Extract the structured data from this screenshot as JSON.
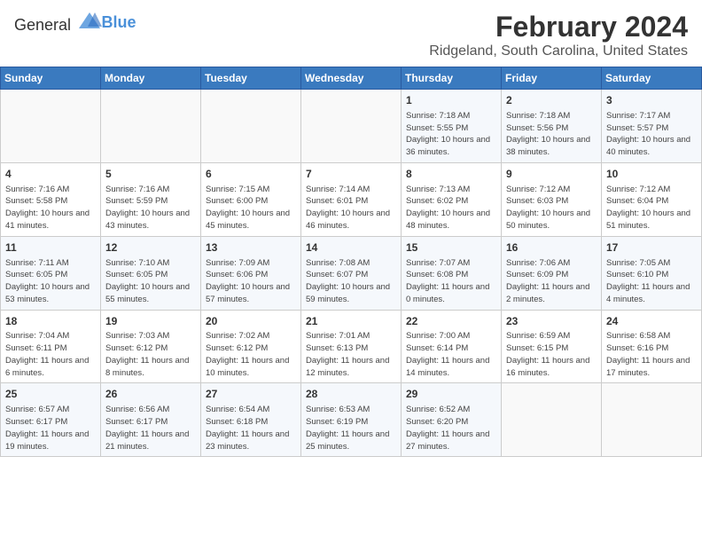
{
  "header": {
    "logo_general": "General",
    "logo_blue": "Blue",
    "title": "February 2024",
    "subtitle": "Ridgeland, South Carolina, United States"
  },
  "columns": [
    "Sunday",
    "Monday",
    "Tuesday",
    "Wednesday",
    "Thursday",
    "Friday",
    "Saturday"
  ],
  "weeks": [
    [
      {
        "day": "",
        "info": ""
      },
      {
        "day": "",
        "info": ""
      },
      {
        "day": "",
        "info": ""
      },
      {
        "day": "",
        "info": ""
      },
      {
        "day": "1",
        "info": "Sunrise: 7:18 AM\nSunset: 5:55 PM\nDaylight: 10 hours\nand 36 minutes."
      },
      {
        "day": "2",
        "info": "Sunrise: 7:18 AM\nSunset: 5:56 PM\nDaylight: 10 hours\nand 38 minutes."
      },
      {
        "day": "3",
        "info": "Sunrise: 7:17 AM\nSunset: 5:57 PM\nDaylight: 10 hours\nand 40 minutes."
      }
    ],
    [
      {
        "day": "4",
        "info": "Sunrise: 7:16 AM\nSunset: 5:58 PM\nDaylight: 10 hours\nand 41 minutes."
      },
      {
        "day": "5",
        "info": "Sunrise: 7:16 AM\nSunset: 5:59 PM\nDaylight: 10 hours\nand 43 minutes."
      },
      {
        "day": "6",
        "info": "Sunrise: 7:15 AM\nSunset: 6:00 PM\nDaylight: 10 hours\nand 45 minutes."
      },
      {
        "day": "7",
        "info": "Sunrise: 7:14 AM\nSunset: 6:01 PM\nDaylight: 10 hours\nand 46 minutes."
      },
      {
        "day": "8",
        "info": "Sunrise: 7:13 AM\nSunset: 6:02 PM\nDaylight: 10 hours\nand 48 minutes."
      },
      {
        "day": "9",
        "info": "Sunrise: 7:12 AM\nSunset: 6:03 PM\nDaylight: 10 hours\nand 50 minutes."
      },
      {
        "day": "10",
        "info": "Sunrise: 7:12 AM\nSunset: 6:04 PM\nDaylight: 10 hours\nand 51 minutes."
      }
    ],
    [
      {
        "day": "11",
        "info": "Sunrise: 7:11 AM\nSunset: 6:05 PM\nDaylight: 10 hours\nand 53 minutes."
      },
      {
        "day": "12",
        "info": "Sunrise: 7:10 AM\nSunset: 6:05 PM\nDaylight: 10 hours\nand 55 minutes."
      },
      {
        "day": "13",
        "info": "Sunrise: 7:09 AM\nSunset: 6:06 PM\nDaylight: 10 hours\nand 57 minutes."
      },
      {
        "day": "14",
        "info": "Sunrise: 7:08 AM\nSunset: 6:07 PM\nDaylight: 10 hours\nand 59 minutes."
      },
      {
        "day": "15",
        "info": "Sunrise: 7:07 AM\nSunset: 6:08 PM\nDaylight: 11 hours\nand 0 minutes."
      },
      {
        "day": "16",
        "info": "Sunrise: 7:06 AM\nSunset: 6:09 PM\nDaylight: 11 hours\nand 2 minutes."
      },
      {
        "day": "17",
        "info": "Sunrise: 7:05 AM\nSunset: 6:10 PM\nDaylight: 11 hours\nand 4 minutes."
      }
    ],
    [
      {
        "day": "18",
        "info": "Sunrise: 7:04 AM\nSunset: 6:11 PM\nDaylight: 11 hours\nand 6 minutes."
      },
      {
        "day": "19",
        "info": "Sunrise: 7:03 AM\nSunset: 6:12 PM\nDaylight: 11 hours\nand 8 minutes."
      },
      {
        "day": "20",
        "info": "Sunrise: 7:02 AM\nSunset: 6:12 PM\nDaylight: 11 hours\nand 10 minutes."
      },
      {
        "day": "21",
        "info": "Sunrise: 7:01 AM\nSunset: 6:13 PM\nDaylight: 11 hours\nand 12 minutes."
      },
      {
        "day": "22",
        "info": "Sunrise: 7:00 AM\nSunset: 6:14 PM\nDaylight: 11 hours\nand 14 minutes."
      },
      {
        "day": "23",
        "info": "Sunrise: 6:59 AM\nSunset: 6:15 PM\nDaylight: 11 hours\nand 16 minutes."
      },
      {
        "day": "24",
        "info": "Sunrise: 6:58 AM\nSunset: 6:16 PM\nDaylight: 11 hours\nand 17 minutes."
      }
    ],
    [
      {
        "day": "25",
        "info": "Sunrise: 6:57 AM\nSunset: 6:17 PM\nDaylight: 11 hours\nand 19 minutes."
      },
      {
        "day": "26",
        "info": "Sunrise: 6:56 AM\nSunset: 6:17 PM\nDaylight: 11 hours\nand 21 minutes."
      },
      {
        "day": "27",
        "info": "Sunrise: 6:54 AM\nSunset: 6:18 PM\nDaylight: 11 hours\nand 23 minutes."
      },
      {
        "day": "28",
        "info": "Sunrise: 6:53 AM\nSunset: 6:19 PM\nDaylight: 11 hours\nand 25 minutes."
      },
      {
        "day": "29",
        "info": "Sunrise: 6:52 AM\nSunset: 6:20 PM\nDaylight: 11 hours\nand 27 minutes."
      },
      {
        "day": "",
        "info": ""
      },
      {
        "day": "",
        "info": ""
      }
    ]
  ]
}
